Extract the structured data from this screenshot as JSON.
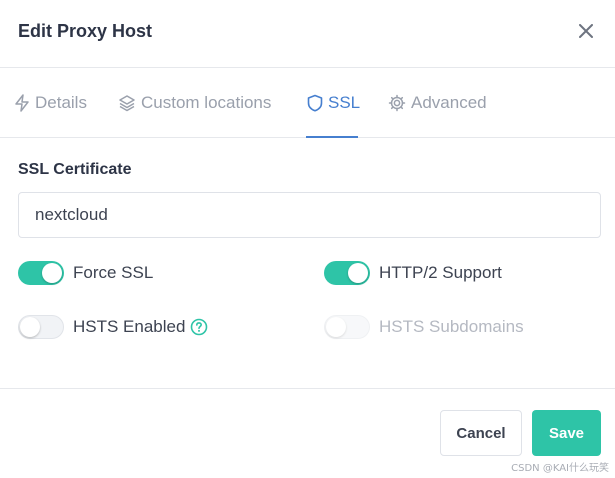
{
  "modal": {
    "title": "Edit Proxy Host"
  },
  "tabs": [
    {
      "label": "Details",
      "icon": "bolt-icon"
    },
    {
      "label": "Custom locations",
      "icon": "layers-icon"
    },
    {
      "label": "SSL",
      "icon": "shield-icon",
      "active": true
    },
    {
      "label": "Advanced",
      "icon": "gear-icon"
    }
  ],
  "ssl": {
    "certificate_label": "SSL Certificate",
    "certificate_value": "nextcloud",
    "force_ssl": {
      "label": "Force SSL",
      "checked": true
    },
    "http2": {
      "label": "HTTP/2 Support",
      "checked": true
    },
    "hsts": {
      "label": "HSTS Enabled",
      "checked": false
    },
    "hsts_subdomains": {
      "label": "HSTS Subdomains",
      "checked": false,
      "disabled": true
    }
  },
  "footer": {
    "cancel_label": "Cancel",
    "save_label": "Save"
  },
  "watermark": "CSDN @KAI什么玩笑",
  "colors": {
    "accent": "#2ec4a7",
    "tab_active": "#467fcf",
    "text": "#3d4351",
    "muted": "#9aa0ac"
  }
}
